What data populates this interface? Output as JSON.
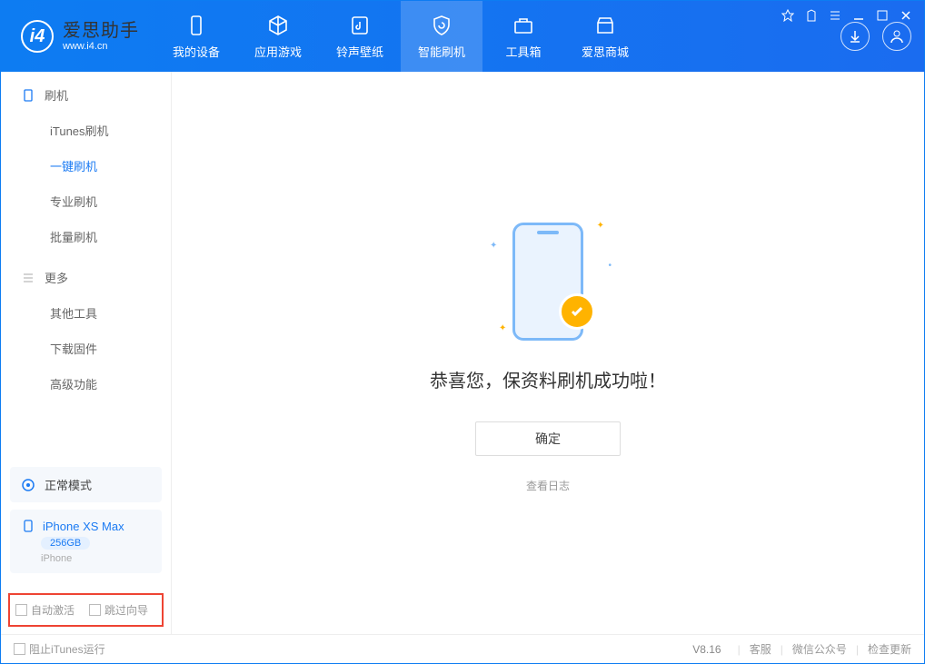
{
  "app": {
    "name": "爱思助手",
    "url": "www.i4.cn"
  },
  "tabs": [
    {
      "label": "我的设备"
    },
    {
      "label": "应用游戏"
    },
    {
      "label": "铃声壁纸"
    },
    {
      "label": "智能刷机"
    },
    {
      "label": "工具箱"
    },
    {
      "label": "爱思商城"
    }
  ],
  "sidebar": {
    "section1_title": "刷机",
    "items1": [
      {
        "label": "iTunes刷机"
      },
      {
        "label": "一键刷机"
      },
      {
        "label": "专业刷机"
      },
      {
        "label": "批量刷机"
      }
    ],
    "section2_title": "更多",
    "items2": [
      {
        "label": "其他工具"
      },
      {
        "label": "下载固件"
      },
      {
        "label": "高级功能"
      }
    ]
  },
  "mode": {
    "label": "正常模式"
  },
  "device": {
    "name": "iPhone XS Max",
    "storage": "256GB",
    "type": "iPhone"
  },
  "options": {
    "auto_activate": "自动激活",
    "skip_guide": "跳过向导"
  },
  "main": {
    "success": "恭喜您，保资料刷机成功啦！",
    "ok": "确定",
    "view_log": "查看日志"
  },
  "footer": {
    "block_itunes": "阻止iTunes运行",
    "version": "V8.16",
    "links": [
      "客服",
      "微信公众号",
      "检查更新"
    ]
  }
}
